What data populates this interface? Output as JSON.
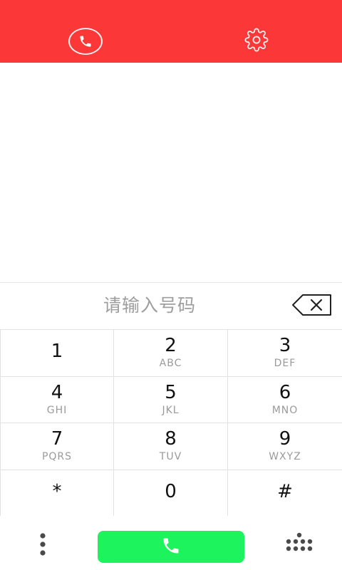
{
  "header": {
    "call_icon": "phone-circle-icon",
    "settings_icon": "gear-icon",
    "background": "#fb3737"
  },
  "dialer": {
    "input_placeholder": "请输入号码",
    "backspace_icon": "backspace-icon"
  },
  "keypad": {
    "keys": [
      {
        "digit": "1",
        "letters": ""
      },
      {
        "digit": "2",
        "letters": "ABC"
      },
      {
        "digit": "3",
        "letters": "DEF"
      },
      {
        "digit": "4",
        "letters": "GHI"
      },
      {
        "digit": "5",
        "letters": "JKL"
      },
      {
        "digit": "6",
        "letters": "MNO"
      },
      {
        "digit": "7",
        "letters": "PQRS"
      },
      {
        "digit": "8",
        "letters": "TUV"
      },
      {
        "digit": "9",
        "letters": "WXYZ"
      },
      {
        "digit": "*",
        "letters": ""
      },
      {
        "digit": "0",
        "letters": ""
      },
      {
        "digit": "#",
        "letters": ""
      }
    ]
  },
  "bottom_bar": {
    "menu_icon": "more-vertical-icon",
    "call_icon": "phone-icon",
    "call_button_color": "#1df35c",
    "keypad_icon": "dialpad-icon"
  }
}
